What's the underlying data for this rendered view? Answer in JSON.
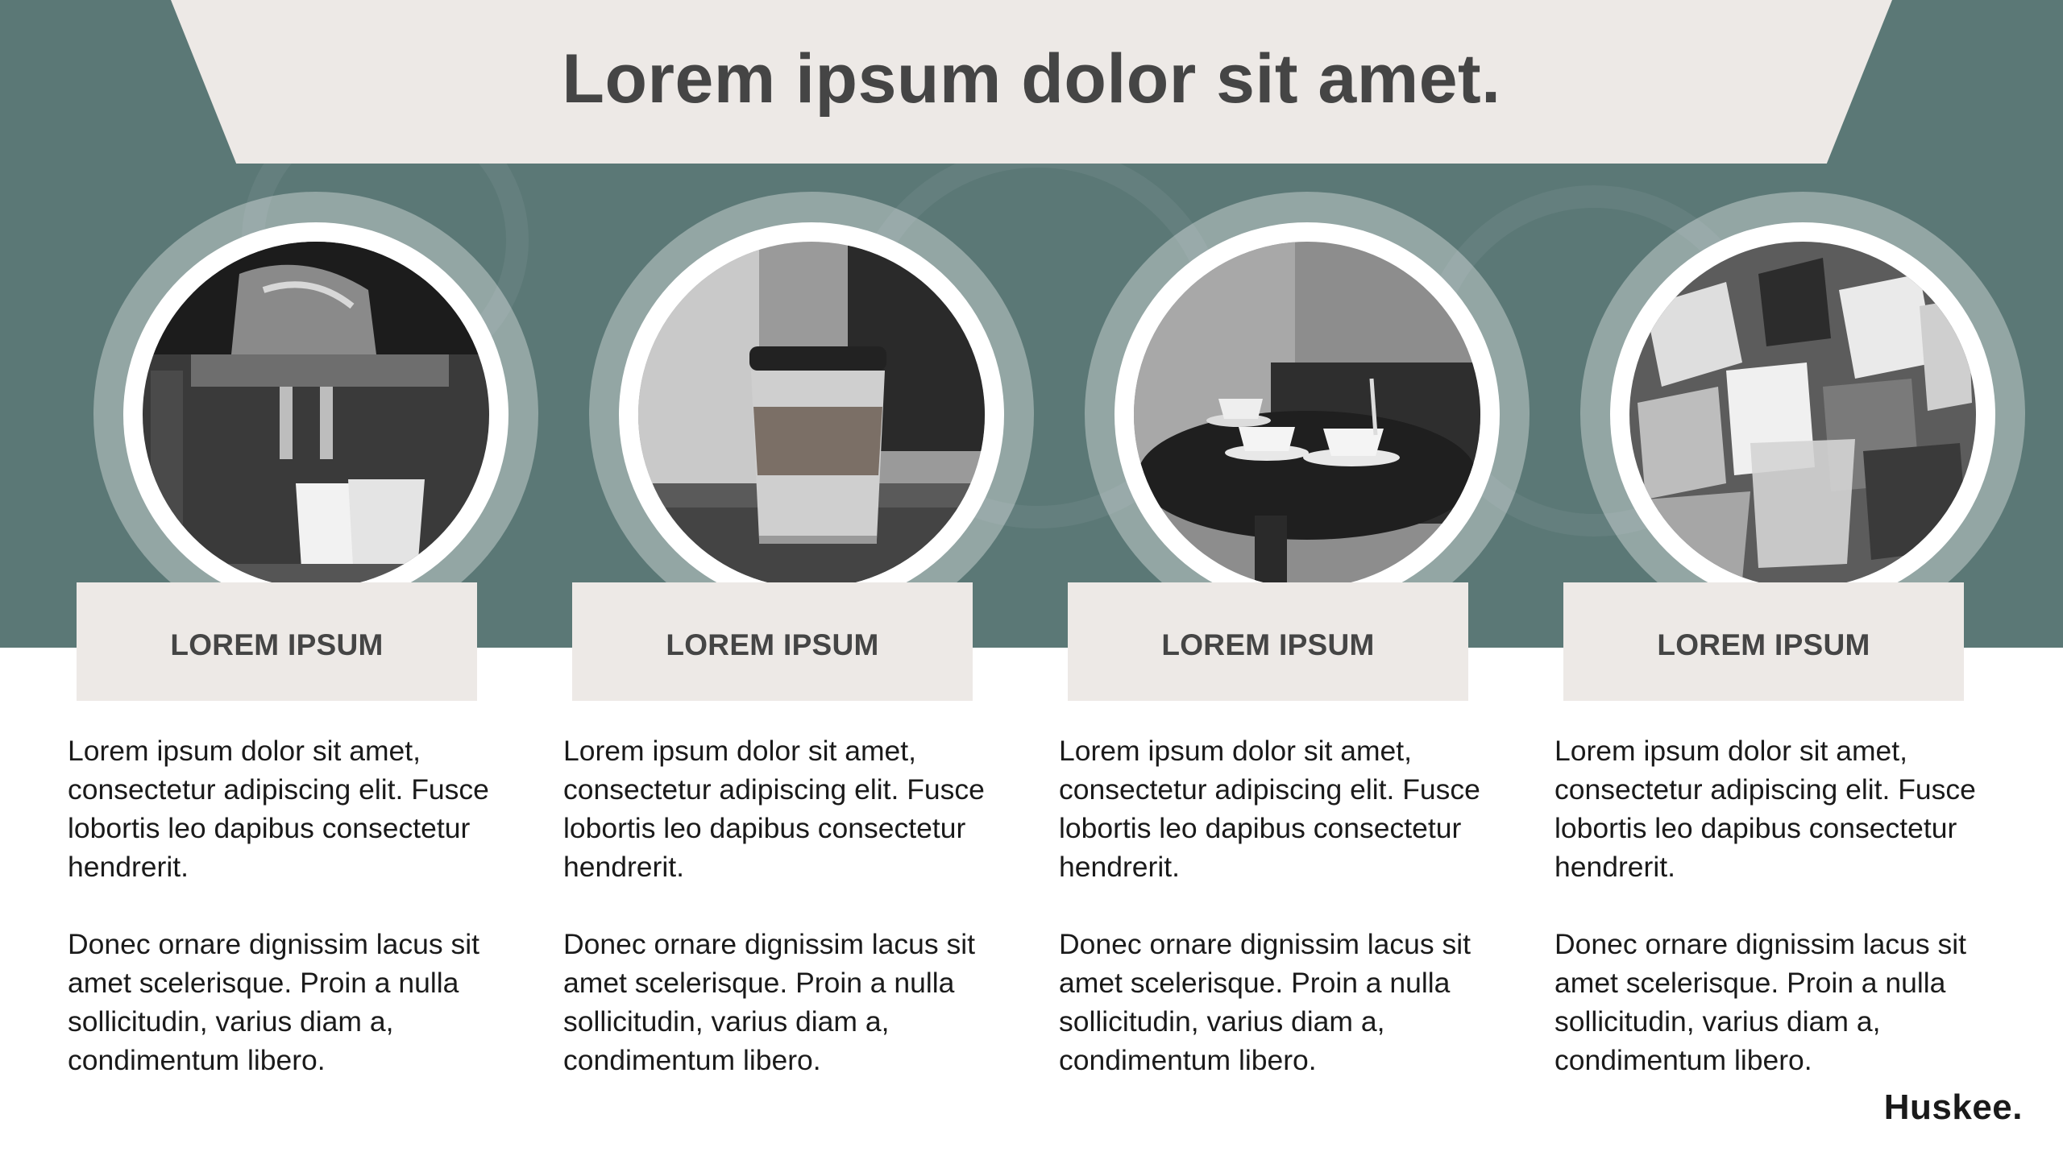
{
  "slide": {
    "title": "Lorem ipsum dolor sit amet.",
    "logo_text": "Huskee."
  },
  "cards": [
    {
      "label": "LOREM IPSUM",
      "paragraph_1": "Lorem ipsum dolor sit amet, consectetur adipiscing elit. Fusce lobortis leo dapibus consectetur hendrerit.",
      "paragraph_2": "Donec ornare dignissim lacus sit amet scelerisque. Proin a nulla sollicitudin, varius diam a, condimentum libero.",
      "image_subject": "espresso-machine-photo"
    },
    {
      "label": "LOREM IPSUM",
      "paragraph_1": "Lorem ipsum dolor sit amet, consectetur adipiscing elit. Fusce lobortis leo dapibus consectetur hendrerit.",
      "paragraph_2": "Donec ornare dignissim lacus sit amet scelerisque. Proin a nulla sollicitudin, varius diam a, condimentum libero.",
      "image_subject": "reusable-cup-photo"
    },
    {
      "label": "LOREM IPSUM",
      "paragraph_1": "Lorem ipsum dolor sit amet, consectetur adipiscing elit. Fusce lobortis leo dapibus consectetur hendrerit.",
      "paragraph_2": "Donec ornare dignissim lacus sit amet scelerisque. Proin a nulla sollicitudin, varius diam a, condimentum libero.",
      "image_subject": "cafe-table-cups-photo"
    },
    {
      "label": "LOREM IPSUM",
      "paragraph_1": "Lorem ipsum dolor sit amet, consectetur adipiscing elit. Fusce lobortis leo dapibus consectetur hendrerit.",
      "paragraph_2": "Donec ornare dignissim lacus sit amet scelerisque. Proin a nulla sollicitudin, varius diam a, condimentum libero.",
      "image_subject": "disposable-cup-waste-photo"
    }
  ],
  "colors": {
    "hero_teal": "#5b7876",
    "banner_beige": "#ede9e6",
    "heading_gray": "#454545",
    "body_text": "#1a1a1a"
  }
}
